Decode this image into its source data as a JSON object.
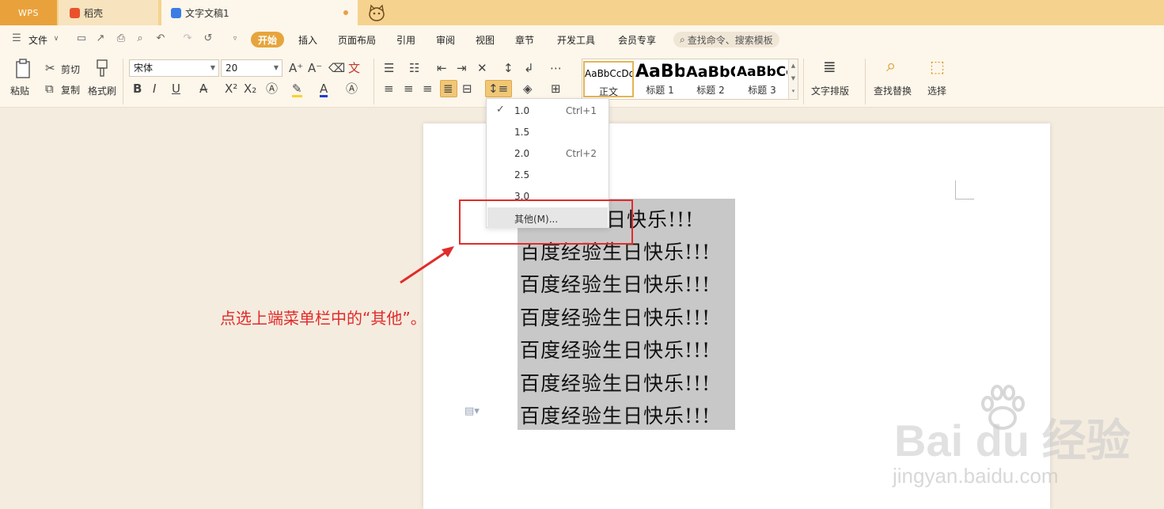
{
  "tabs": {
    "wps": "WPS",
    "daoke": "稻壳",
    "doc": "文字文稿1"
  },
  "menu": {
    "file": "文件",
    "items": [
      "开始",
      "插入",
      "页面布局",
      "引用",
      "审阅",
      "视图",
      "章节",
      "开发工具",
      "会员专享"
    ],
    "search": "查找命令、搜索模板"
  },
  "ribbon": {
    "paste": "粘贴",
    "cut": "剪切",
    "copy": "复制",
    "format_painter": "格式刷",
    "font_name": "宋体",
    "font_size": "20",
    "styles": [
      {
        "preview": "AaBbCcDd",
        "name": "正文"
      },
      {
        "preview": "AaBb",
        "name": "标题 1"
      },
      {
        "preview": "AaBbC",
        "name": "标题 2"
      },
      {
        "preview": "AaBbCc",
        "name": "标题 3"
      }
    ],
    "text_layout": "文字排版",
    "find_replace": "查找替换",
    "select": "选择"
  },
  "line_spacing_menu": {
    "items": [
      {
        "value": "1.0",
        "shortcut": "Ctrl+1",
        "checked": true
      },
      {
        "value": "1.5",
        "shortcut": "",
        "checked": false
      },
      {
        "value": "2.0",
        "shortcut": "Ctrl+2",
        "checked": false
      },
      {
        "value": "2.5",
        "shortcut": "",
        "checked": false
      },
      {
        "value": "3.0",
        "shortcut": "",
        "checked": false
      },
      {
        "value": "其他(M)...",
        "shortcut": "",
        "checked": false
      }
    ]
  },
  "document": {
    "first_line_visible": "生日快乐!!!",
    "lines": [
      "百度经验生日快乐!!!",
      "百度经验生日快乐!!!",
      "百度经验生日快乐!!!",
      "百度经验生日快乐!!!",
      "百度经验生日快乐!!!",
      "百度经验生日快乐!!!"
    ]
  },
  "annotation": {
    "caption": "点选上端菜单栏中的“其他”。",
    "color": "#e12b2b"
  },
  "watermark": {
    "brand": "Bai du 经验",
    "url": "jingyan.baidu.com"
  },
  "colors": {
    "accent": "#e6a53c",
    "titlebar": "#f5d28e"
  }
}
